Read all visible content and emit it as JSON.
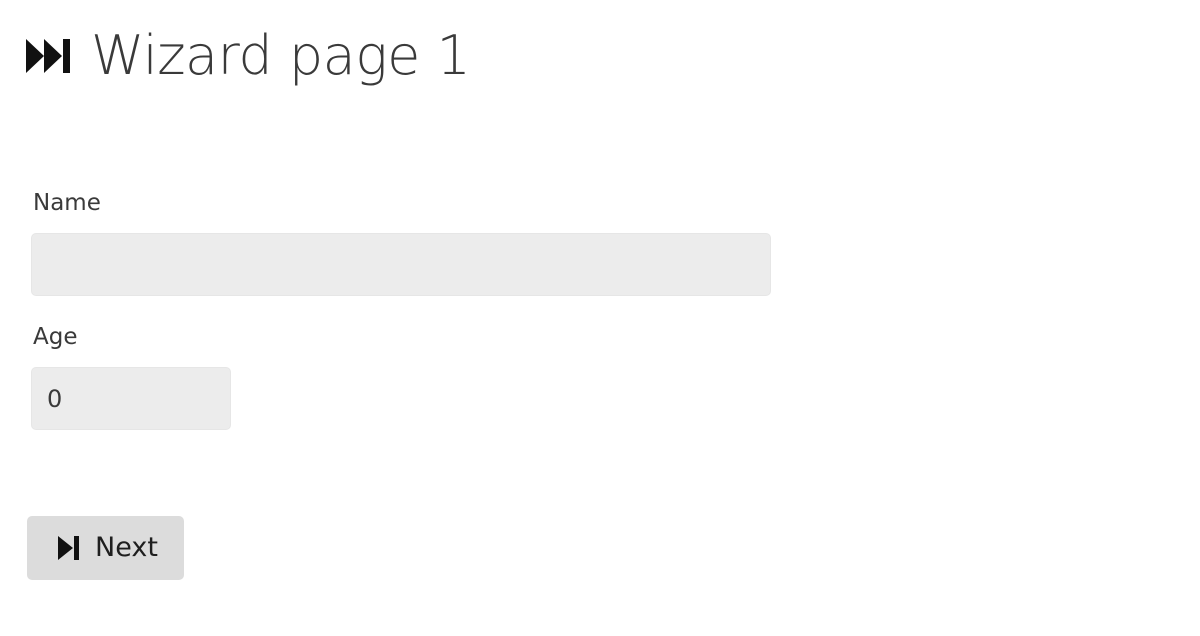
{
  "header": {
    "icon": "fast-forward-to-end-icon",
    "title": "Wizard page 1"
  },
  "form": {
    "name": {
      "label": "Name",
      "value": ""
    },
    "age": {
      "label": "Age",
      "value": "0"
    }
  },
  "actions": {
    "next": {
      "icon": "skip-next-icon",
      "label": "Next"
    }
  },
  "colors": {
    "text": "#3a3a3a",
    "input_background": "#ececec",
    "button_background": "#dcdcdc"
  }
}
